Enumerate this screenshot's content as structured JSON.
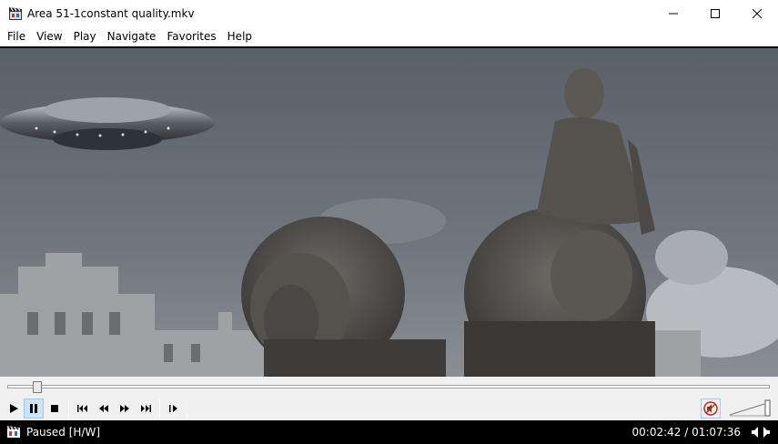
{
  "window": {
    "title": "Area 51-1constant quality.mkv"
  },
  "menu": {
    "items": [
      "File",
      "View",
      "Play",
      "Navigate",
      "Favorites",
      "Help"
    ]
  },
  "player": {
    "seek_progress": 0.0396,
    "volume_level": 1.0,
    "mute_active": true
  },
  "status": {
    "state": "Paused [H/W]",
    "time": "00:02:42 / 01:07:36"
  },
  "icons": {
    "app": "clapperboard-icon",
    "minimize": "minimize-icon",
    "maximize": "maximize-icon",
    "close": "close-icon",
    "play": "play-icon",
    "pause": "pause-icon",
    "stop": "stop-icon",
    "prev": "skip-back-icon",
    "rewind": "rewind-icon",
    "forward": "fast-forward-icon",
    "next": "skip-forward-icon",
    "frame_step": "frame-step-icon",
    "mute": "mute-icon",
    "volume": "volume-slider-icon"
  },
  "colors": {
    "status_bg": "#000000",
    "controls_bg": "#f0f0f0",
    "active_button": "#cce4f7"
  }
}
